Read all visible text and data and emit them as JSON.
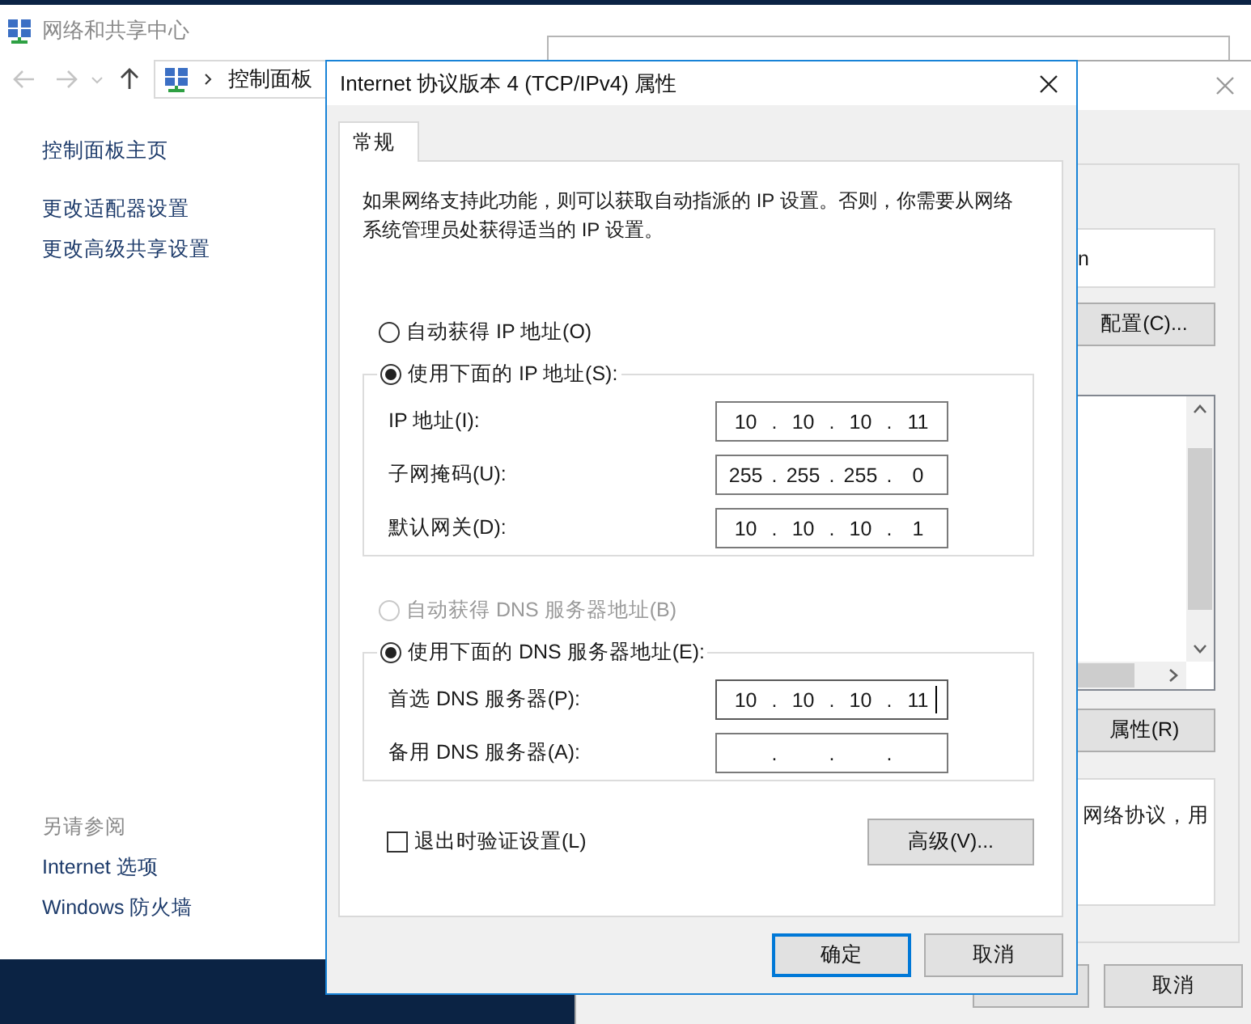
{
  "control_panel": {
    "title": "网络和共享中心",
    "breadcrumb": [
      "控制面板"
    ],
    "sidebar": {
      "links": [
        "控制面板主页",
        "更改适配器设置",
        "更改高级共享设置"
      ],
      "see_also_heading": "另请参阅",
      "see_also": [
        "Internet 选项",
        "Windows 防火墙"
      ]
    }
  },
  "ethernet_properties": {
    "adapter_name": "n",
    "configure_button": "配置(C)...",
    "properties_button": "属性(R)",
    "description": "网络协议，用",
    "cancel_button": "取消"
  },
  "ipv4_dialog": {
    "title": "Internet 协议版本 4 (TCP/IPv4) 属性",
    "tabs": [
      {
        "label": "常规",
        "selected": true
      }
    ],
    "intro": "如果网络支持此功能，则可以获取自动指派的 IP 设置。否则，你需要从网络系统管理员处获得适当的 IP 设置。",
    "ip_options": [
      {
        "label": "自动获得 IP 地址(O)",
        "selected": false,
        "disabled": false
      },
      {
        "label": "使用下面的 IP 地址(S):",
        "selected": true,
        "disabled": false,
        "fields": [
          {
            "label": "IP 地址(I):",
            "octets": [
              "10",
              "10",
              "10",
              "11"
            ],
            "separator": ".",
            "focused": false
          },
          {
            "label": "子网掩码(U):",
            "octets": [
              "255",
              "255",
              "255",
              "0"
            ],
            "separator": ".",
            "focused": false
          },
          {
            "label": "默认网关(D):",
            "octets": [
              "10",
              "10",
              "10",
              "1"
            ],
            "separator": ".",
            "focused": false
          }
        ]
      }
    ],
    "dns_options": [
      {
        "label": "自动获得 DNS 服务器地址(B)",
        "selected": false,
        "disabled": true
      },
      {
        "label": "使用下面的 DNS 服务器地址(E):",
        "selected": true,
        "disabled": false,
        "fields": [
          {
            "label": "首选 DNS 服务器(P):",
            "octets": [
              "10",
              "10",
              "10",
              "11"
            ],
            "separator": ".",
            "focused": true
          },
          {
            "label": "备用 DNS 服务器(A):",
            "separator": ".",
            "focused": false
          }
        ]
      }
    ],
    "validate_checkbox": {
      "label": "退出时验证设置(L)",
      "checked": false
    },
    "advanced_button": "高级(V)...",
    "buttons": [
      {
        "label": "确定",
        "default": true
      },
      {
        "label": "取消",
        "default": false
      }
    ]
  }
}
